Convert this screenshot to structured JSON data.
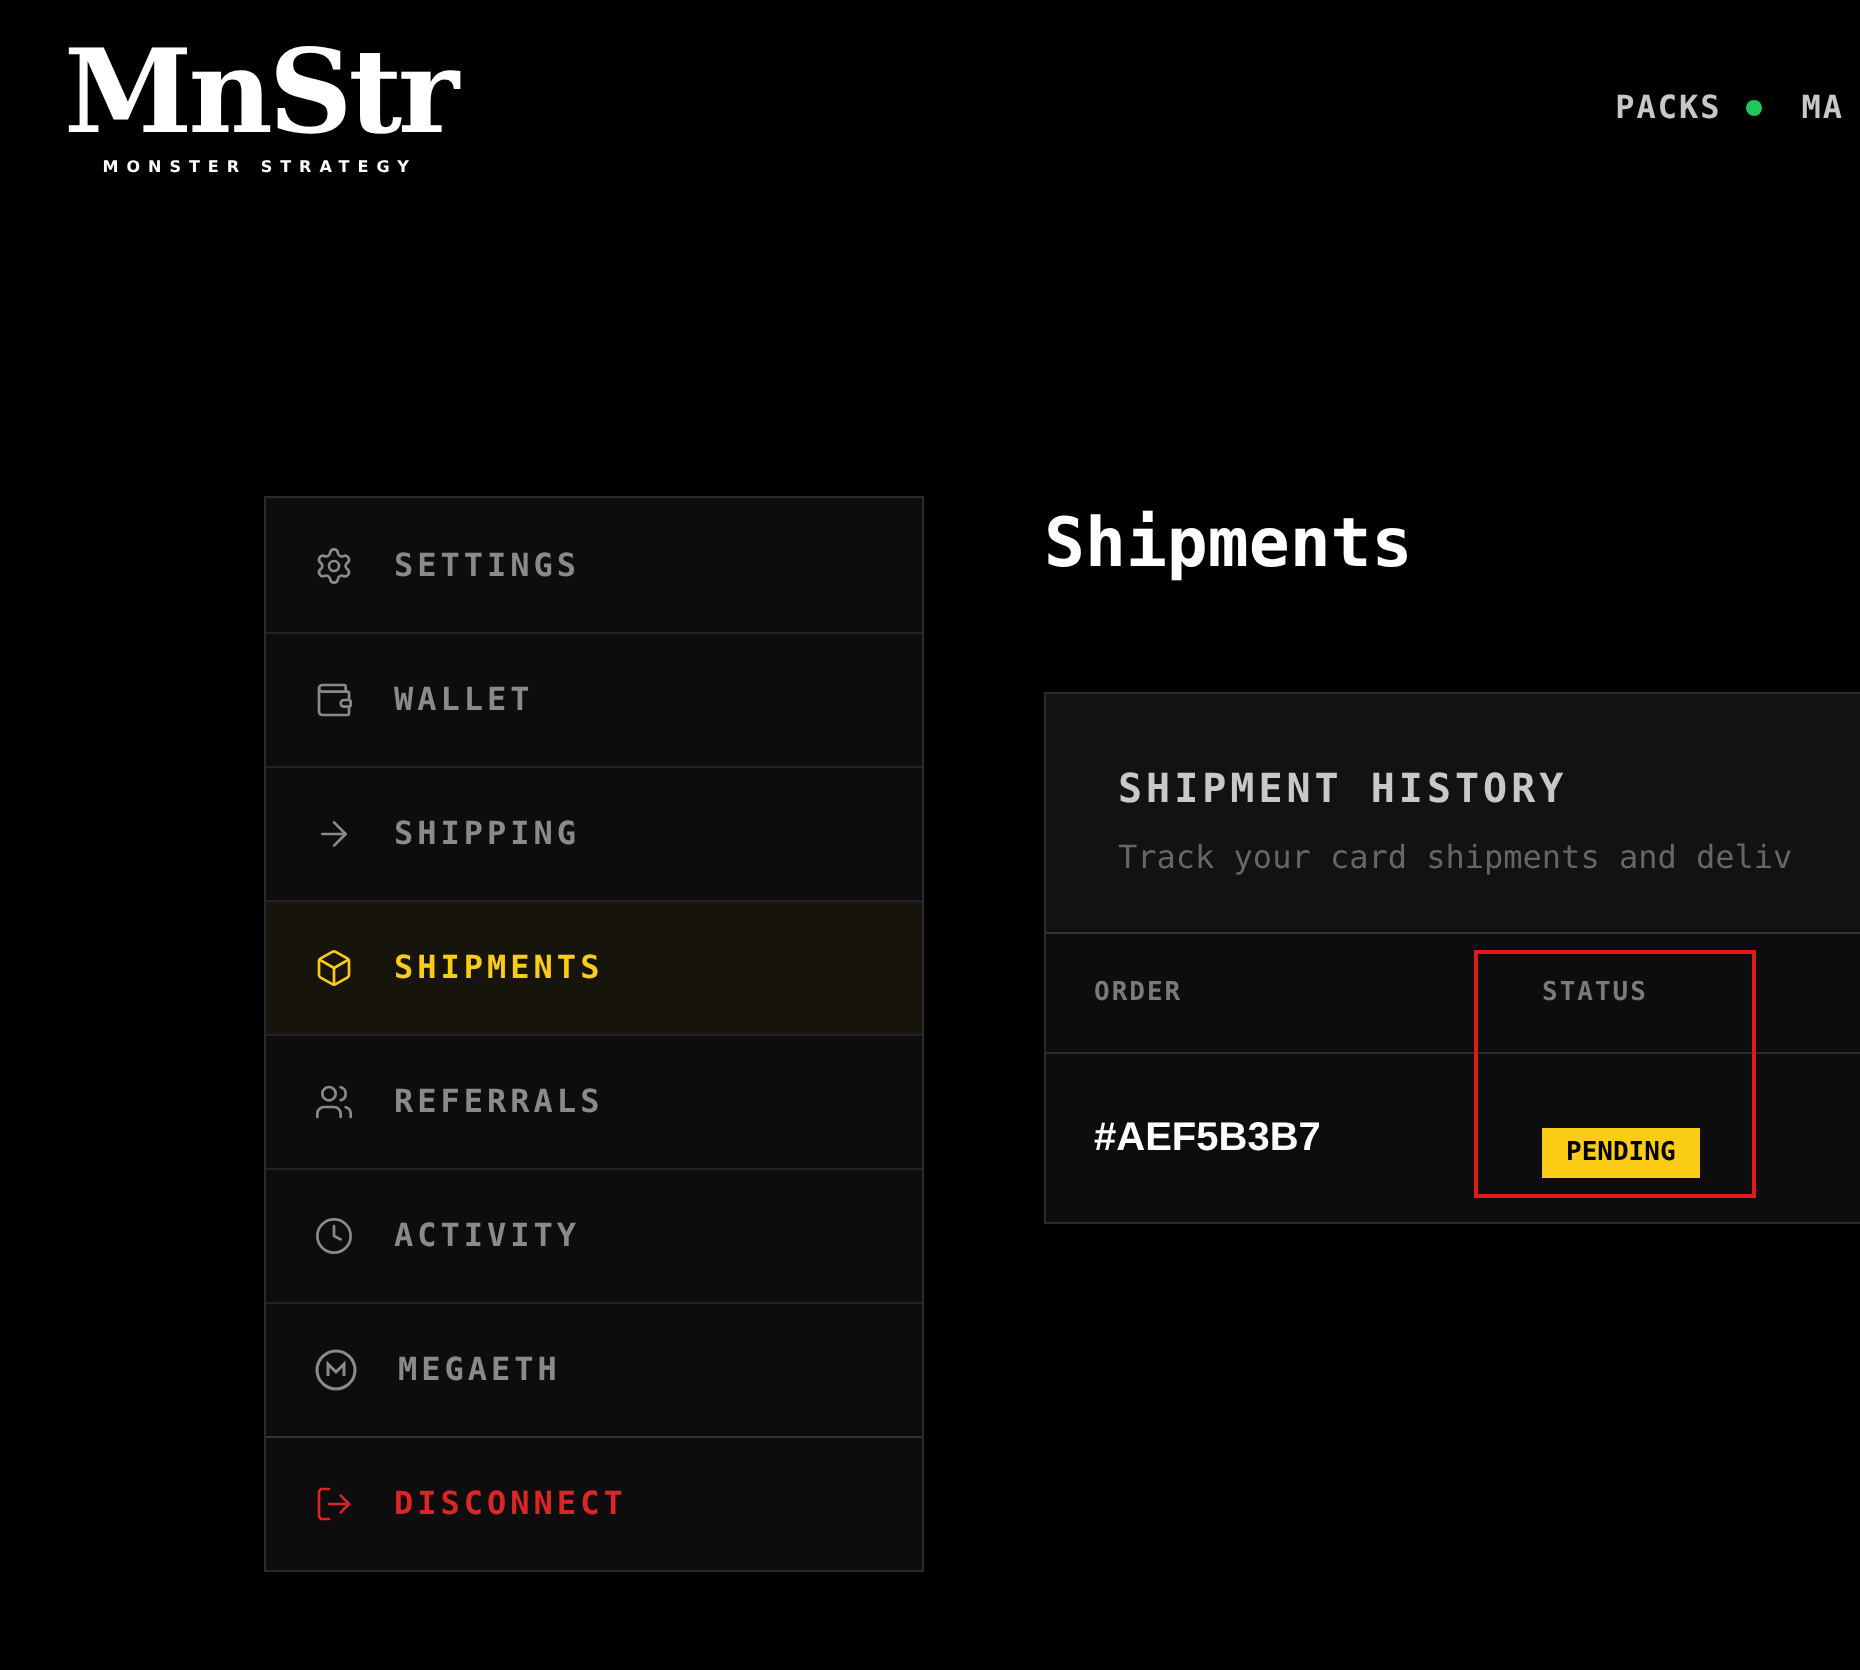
{
  "logo": {
    "mark": "MnStr",
    "tagline": "MONSTER STRATEGY"
  },
  "nav": [
    {
      "label": "PACKS",
      "live": true
    },
    {
      "label": "MA",
      "live": false
    }
  ],
  "sidebar": {
    "items": [
      {
        "kind": "gear",
        "label": "SETTINGS",
        "selected": false
      },
      {
        "kind": "wallet",
        "label": "WALLET",
        "selected": false
      },
      {
        "kind": "arrow",
        "label": "SHIPPING",
        "selected": false
      },
      {
        "kind": "box",
        "label": "SHIPMENTS",
        "selected": true
      },
      {
        "kind": "people",
        "label": "REFERRALS",
        "selected": false
      },
      {
        "kind": "clock",
        "label": "ACTIVITY",
        "selected": false
      },
      {
        "kind": "coin",
        "label": "MEGAETH",
        "selected": false
      },
      {
        "kind": "logout",
        "label": "DISCONNECT",
        "selected": false
      }
    ]
  },
  "page_title": "Shipments",
  "card": {
    "title": "SHIPMENT HISTORY",
    "subtitle": "Track your card shipments and deliv",
    "table": {
      "columns": [
        {
          "label": "ORDER",
          "highlighted": false
        },
        {
          "label": "STATUS",
          "highlighted": true
        }
      ],
      "rows": [
        {
          "order": "#AEF5B3B7",
          "status": "PENDING"
        }
      ]
    }
  }
}
